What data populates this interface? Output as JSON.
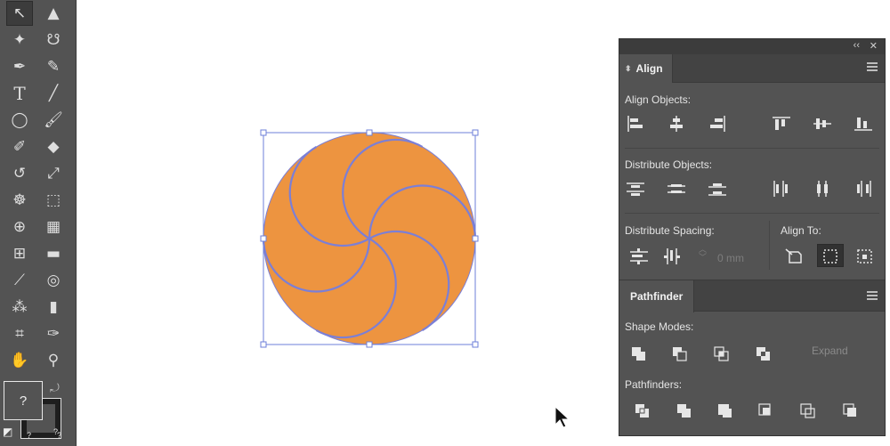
{
  "toolbar": {
    "tools": [
      {
        "name": "selection-tool",
        "glyph": "↖",
        "active": true
      },
      {
        "name": "direct-selection-tool",
        "glyph": "▲",
        "active": false
      },
      {
        "name": "magic-wand-tool",
        "glyph": "✦",
        "active": false
      },
      {
        "name": "lasso-tool",
        "glyph": "☋",
        "active": false
      },
      {
        "name": "pen-tool",
        "glyph": "✒",
        "active": false
      },
      {
        "name": "curvature-tool",
        "glyph": "✎",
        "active": false
      },
      {
        "name": "type-tool",
        "glyph": "T",
        "active": false
      },
      {
        "name": "line-segment-tool",
        "glyph": "╱",
        "active": false
      },
      {
        "name": "ellipse-tool",
        "glyph": "◯",
        "active": false
      },
      {
        "name": "paintbrush-tool",
        "glyph": "🖌",
        "active": false
      },
      {
        "name": "shaper-tool",
        "glyph": "✐",
        "active": false
      },
      {
        "name": "eraser-tool",
        "glyph": "◆",
        "active": false
      },
      {
        "name": "rotate-tool",
        "glyph": "↺",
        "active": false
      },
      {
        "name": "scale-tool",
        "glyph": "⤢",
        "active": false
      },
      {
        "name": "warp-tool",
        "glyph": "☸",
        "active": false
      },
      {
        "name": "free-transform-tool",
        "glyph": "⬚",
        "active": false
      },
      {
        "name": "shape-builder-tool",
        "glyph": "⊕",
        "active": false
      },
      {
        "name": "perspective-grid-tool",
        "glyph": "▦",
        "active": false
      },
      {
        "name": "mesh-tool",
        "glyph": "⊞",
        "active": false
      },
      {
        "name": "gradient-tool",
        "glyph": "▬",
        "active": false
      },
      {
        "name": "eyedropper-tool",
        "glyph": "⟋",
        "active": false
      },
      {
        "name": "blend-tool",
        "glyph": "◎",
        "active": false
      },
      {
        "name": "symbol-sprayer-tool",
        "glyph": "⁂",
        "active": false
      },
      {
        "name": "column-graph-tool",
        "glyph": "▮",
        "active": false
      },
      {
        "name": "artboard-tool",
        "glyph": "⌗",
        "active": false
      },
      {
        "name": "slice-tool",
        "glyph": "✑",
        "active": false
      },
      {
        "name": "hand-tool",
        "glyph": "✋",
        "active": false
      },
      {
        "name": "zoom-tool",
        "glyph": "⚲",
        "active": false
      }
    ],
    "fill_label": "?",
    "stroke_label": "?",
    "mini_fill_label": "?",
    "mini_stroke_label": "?"
  },
  "artwork": {
    "fill_color": "#ED9440",
    "stroke_color": "#7B7FD6",
    "selection_color": "#6E7FD8"
  },
  "align_panel": {
    "tab_label": "Align",
    "align_objects_label": "Align Objects:",
    "distribute_objects_label": "Distribute Objects:",
    "distribute_spacing_label": "Distribute Spacing:",
    "align_to_label": "Align To:",
    "spacing_value": "0 mm",
    "align_objects_icons": [
      "horizontal-align-left-icon",
      "horizontal-align-center-icon",
      "horizontal-align-right-icon",
      "vertical-align-top-icon",
      "vertical-align-center-icon",
      "vertical-align-bottom-icon"
    ],
    "distribute_objects_icons": [
      "vertical-distribute-top-icon",
      "vertical-distribute-center-icon",
      "vertical-distribute-bottom-icon",
      "horizontal-distribute-left-icon",
      "horizontal-distribute-center-icon",
      "horizontal-distribute-right-icon"
    ]
  },
  "pathfinder_panel": {
    "tab_label": "Pathfinder",
    "shape_modes_label": "Shape Modes:",
    "pathfinders_label": "Pathfinders:",
    "expand_label": "Expand"
  }
}
